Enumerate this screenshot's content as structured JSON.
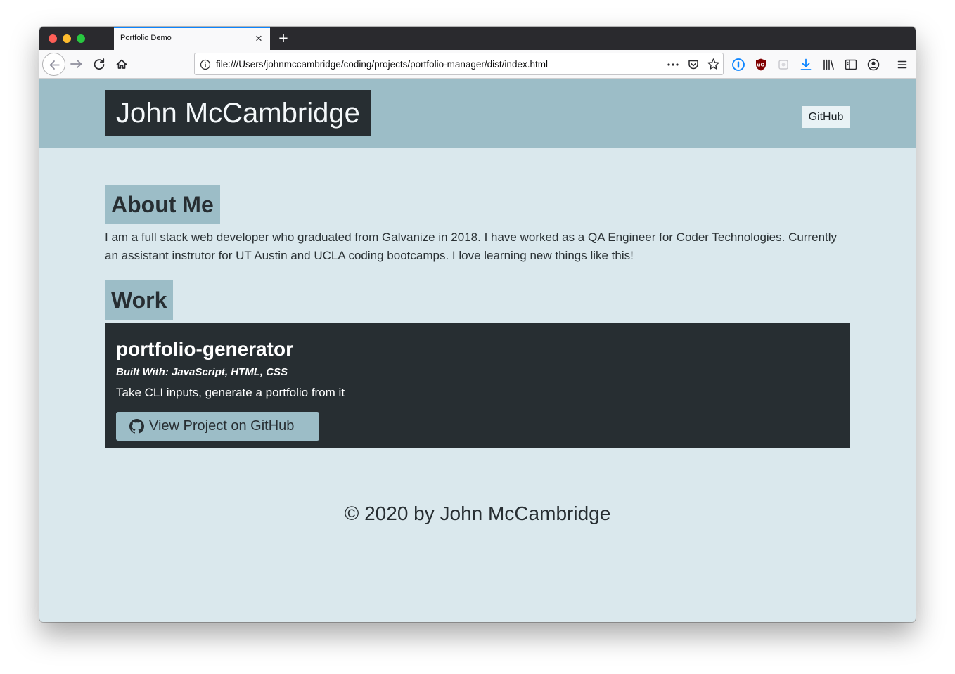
{
  "browser": {
    "tab_title": "Portfolio Demo",
    "url": "file:///Users/johnmccambridge/coding/projects/portfolio-manager/dist/index.html"
  },
  "site": {
    "title": "John McCambridge",
    "nav_github": "GitHub"
  },
  "about": {
    "heading": "About Me",
    "text": "I am a full stack web developer who graduated from Galvanize in 2018. I have worked as a QA Engineer for Coder Technologies. Currently an assistant instrutor for UT Austin and UCLA coding bootcamps. I love learning new things like this!"
  },
  "work": {
    "heading": "Work",
    "projects": [
      {
        "name": "portfolio-generator",
        "built_with": "Built With: JavaScript, HTML, CSS",
        "description": "Take CLI inputs, generate a portfolio from it",
        "button_label": "View Project on GitHub"
      }
    ]
  },
  "footer": {
    "text": "© 2020 by John McCambridge"
  },
  "colors": {
    "header_bg": "#9cbdc7",
    "page_bg": "#dae8ed",
    "dark": "#272e32"
  }
}
